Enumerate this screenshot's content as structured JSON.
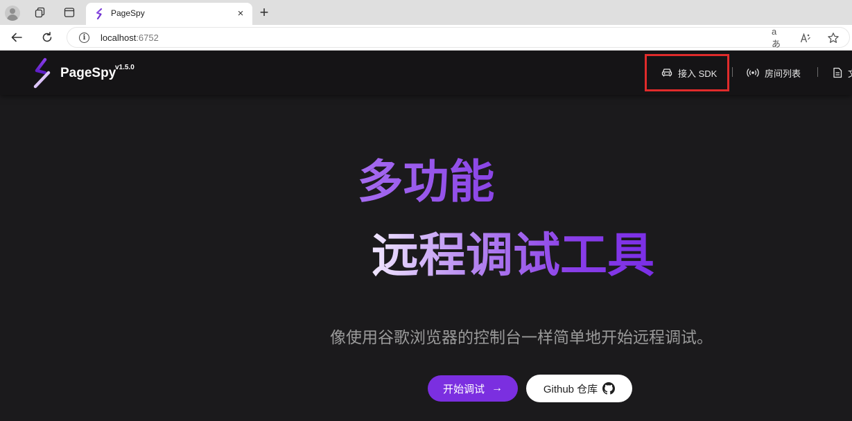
{
  "browser": {
    "tab": {
      "title": "PageSpy",
      "close_glyph": "×"
    },
    "new_tab_glyph": "+",
    "address": {
      "host": "localhost",
      "port": ":6752"
    },
    "omnibox_icons": [
      "read-aloud-icon",
      "immersive-reader-icon",
      "favorite-star-icon"
    ],
    "read_aloud_label": "aあ"
  },
  "app": {
    "brand": "PageSpy",
    "version": "v1.5.0",
    "nav": {
      "sdk": "接入 SDK",
      "rooms": "房间列表",
      "docs": "文"
    },
    "highlight_color": "#e02b2b"
  },
  "hero": {
    "line1": "多功能",
    "line2": "远程调试工具",
    "subtitle": "像使用谷歌浏览器的控制台一样简单地开始远程调试。"
  },
  "buttons": {
    "start": "开始调试",
    "start_arrow": "→",
    "github": "Github 仓库"
  },
  "colors": {
    "accent": "#7b2fe0",
    "background": "#1b1a1c",
    "appbar": "#151416"
  }
}
